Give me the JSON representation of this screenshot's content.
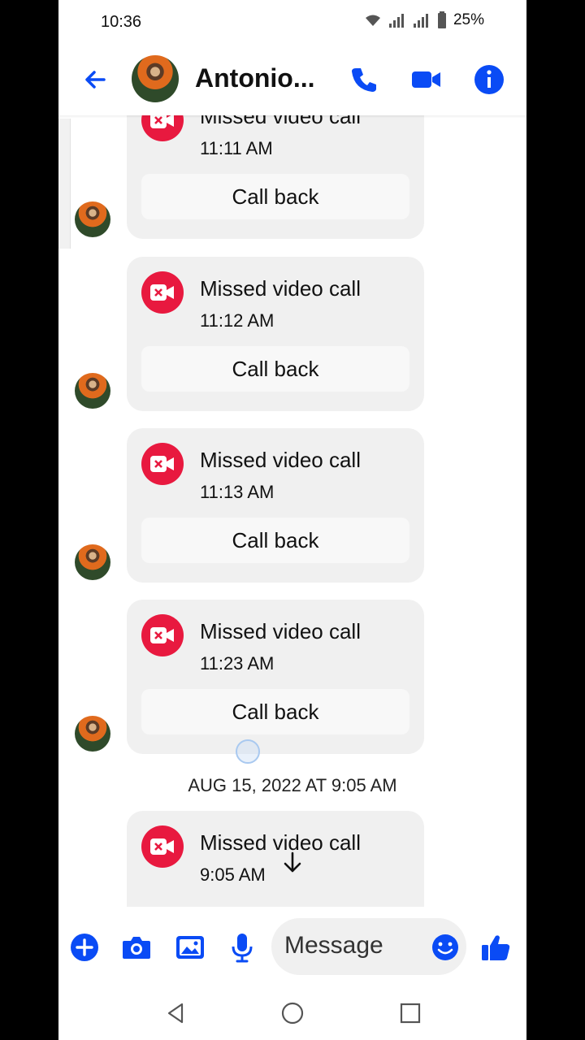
{
  "status_bar": {
    "time": "10:36",
    "battery": "25%"
  },
  "header": {
    "contact_name": "Antonio...",
    "icons": [
      "back-arrow-icon",
      "phone-icon",
      "video-camera-icon",
      "info-icon"
    ]
  },
  "calls": [
    {
      "title": "Missed video call",
      "time": "11:11 AM",
      "action": "Call back"
    },
    {
      "title": "Missed video call",
      "time": "11:12 AM",
      "action": "Call back"
    },
    {
      "title": "Missed video call",
      "time": "11:13 AM",
      "action": "Call back"
    },
    {
      "title": "Missed video call",
      "time": "11:23 AM",
      "action": "Call back"
    },
    {
      "title": "Missed video call",
      "time": "9:05 AM",
      "action": ""
    }
  ],
  "date_separator": "AUG 15, 2022 AT 9:05 AM",
  "composer": {
    "placeholder": "Message",
    "icons": [
      "plus-icon",
      "camera-icon",
      "gallery-icon",
      "microphone-icon",
      "emoji-icon",
      "thumbs-up-icon"
    ]
  },
  "colors": {
    "accent": "#0a4bf5",
    "missed": "#e8193f"
  }
}
